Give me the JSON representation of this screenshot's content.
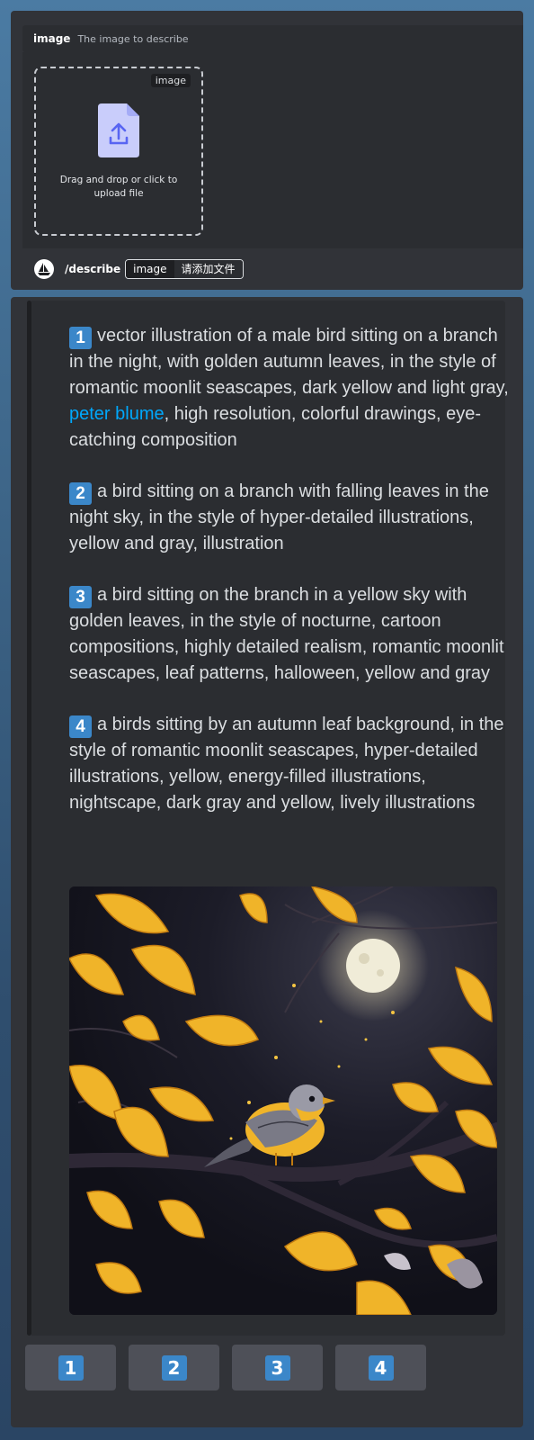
{
  "option": {
    "name": "image",
    "description": "The image to describe"
  },
  "dropzone": {
    "tag": "image",
    "text": "Drag and drop or click to upload file",
    "icon": "upload-file-icon"
  },
  "command": {
    "name": "/describe",
    "chip_key": "image",
    "chip_value": "请添加文件"
  },
  "prompts": [
    {
      "number": "1",
      "text_before": "vector illustration of a male bird sitting on a branch in the night, with golden autumn leaves, in the style of romantic moonlit seascapes, dark yellow and light gray, ",
      "link": "peter blume",
      "text_after": ", high resolution, colorful drawings, eye-catching composition"
    },
    {
      "number": "2",
      "text": "a bird sitting on a branch with falling leaves in the night sky, in the style of hyper-detailed illustrations, yellow and gray, illustration"
    },
    {
      "number": "3",
      "text": "a bird sitting on the branch in a yellow sky with golden leaves, in the style of nocturne, cartoon compositions, highly detailed realism, romantic moonlit seascapes, leaf patterns, halloween, yellow and gray"
    },
    {
      "number": "4",
      "text": "a birds sitting by an autumn leaf background, in the style of romantic moonlit seascapes, hyper-detailed illustrations, yellow, energy-filled illustrations, nightscape, dark gray and yellow, lively illustrations"
    }
  ],
  "buttons": [
    "1",
    "2",
    "3",
    "4"
  ],
  "colors": {
    "accent": "#3b87c9",
    "link": "#00a8fc",
    "panel": "#313338",
    "embed": "#2b2d31",
    "button": "#4e5058"
  }
}
